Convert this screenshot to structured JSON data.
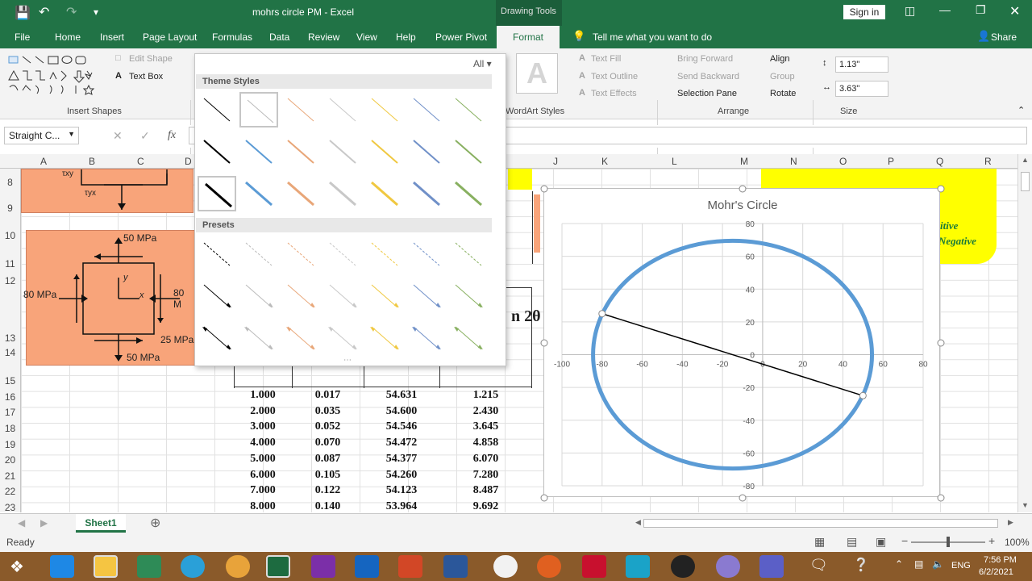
{
  "titlebar": {
    "doc_title": "mohrs circle PM  -  Excel",
    "context_label": "Drawing Tools",
    "signin": "Sign in"
  },
  "tabs": [
    "File",
    "Home",
    "Insert",
    "Page Layout",
    "Formulas",
    "Data",
    "Review",
    "View",
    "Help",
    "Power Pivot",
    "Format"
  ],
  "tell_me": "Tell me what you want to do",
  "share": "Share",
  "ribbon": {
    "edit_shape": "Edit Shape",
    "text_box": "Text Box",
    "insert_shapes_label": "Insert Shapes",
    "all_label": "All",
    "text_fill": "Text Fill",
    "text_outline": "Text Outline",
    "text_effects": "Text Effects",
    "wordart_label": "WordArt Styles",
    "bring_forward": "Bring Forward",
    "send_backward": "Send Backward",
    "selection_pane": "Selection Pane",
    "align": "Align",
    "group": "Group",
    "rotate": "Rotate",
    "arrange_label": "Arrange",
    "height_value": "1.13\"",
    "width_value": "3.63\"",
    "size_label": "Size"
  },
  "formula_bar": {
    "name_box": "Straight C..."
  },
  "gallery": {
    "theme_styles": "Theme Styles",
    "presets": "Presets"
  },
  "columns": [
    "A",
    "B",
    "C",
    "D",
    "J",
    "K",
    "L",
    "M",
    "N",
    "O",
    "P",
    "Q",
    "R"
  ],
  "rows": [
    "8",
    "9",
    "10",
    "11",
    "12",
    "13",
    "14",
    "15",
    "16",
    "17",
    "18",
    "19",
    "20",
    "21",
    "22",
    "23"
  ],
  "diagram": {
    "top_label": "50 MPa",
    "left_label": "80 MPa",
    "right_label": "80 M",
    "shear_label": "25 MPa",
    "bottom_label": "50 MPa",
    "y_axis": "y",
    "x_axis": "x",
    "tau_xy": "τxy",
    "tau_yx": "τyx"
  },
  "note_box": {
    "line1": "itive",
    "line2": "Negative"
  },
  "partial_header": "n 2θ",
  "table": [
    [
      "1.000",
      "0.017",
      "54.631",
      "1.215"
    ],
    [
      "2.000",
      "0.035",
      "54.600",
      "2.430"
    ],
    [
      "3.000",
      "0.052",
      "54.546",
      "3.645"
    ],
    [
      "4.000",
      "0.070",
      "54.472",
      "4.858"
    ],
    [
      "5.000",
      "0.087",
      "54.377",
      "6.070"
    ],
    [
      "6.000",
      "0.105",
      "54.260",
      "7.280"
    ],
    [
      "7.000",
      "0.122",
      "54.123",
      "8.487"
    ],
    [
      "8.000",
      "0.140",
      "53.964",
      "9.692"
    ]
  ],
  "chart_data": {
    "type": "scatter",
    "title": "Mohr's Circle",
    "xlim": [
      -100,
      80
    ],
    "ylim": [
      -80,
      80
    ],
    "x_ticks": [
      -100,
      -80,
      -60,
      -40,
      -20,
      0,
      20,
      40,
      60,
      80
    ],
    "y_ticks": [
      -80,
      -60,
      -40,
      -20,
      0,
      20,
      40,
      60,
      80
    ],
    "grid": true,
    "series": [
      {
        "kind": "circle",
        "center": [
          -15,
          0
        ],
        "radius": 69.5,
        "color": "#5b9bd5"
      },
      {
        "kind": "line",
        "x": [
          -80,
          50
        ],
        "y": [
          25,
          -25
        ],
        "color": "#000000"
      }
    ]
  },
  "sheet_tab": "Sheet1",
  "status": {
    "ready": "Ready",
    "zoom": "100%"
  },
  "clock": {
    "time": "7:56 PM",
    "date": "6/2/2021",
    "lang": "ENG"
  }
}
